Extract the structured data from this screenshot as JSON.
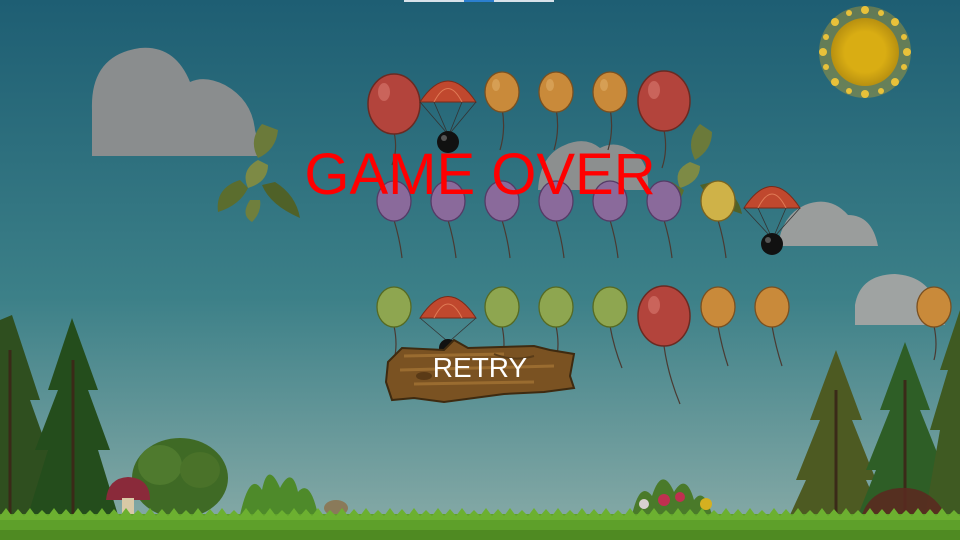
{
  "game": {
    "title": "GAME OVER",
    "retry_label": "RETRY"
  },
  "colors": {
    "sky_top": "#1e5e73",
    "sky_bottom": "#7fa7a9",
    "title": "#ff0000",
    "balloon_red": "#b3443c",
    "balloon_orange": "#c98a3a",
    "balloon_purple": "#8a6a9b",
    "balloon_green": "#8ea650",
    "balloon_yellow": "#cfb248",
    "parachute": "#c0482e",
    "grass": "#5ea02a",
    "sun": "#d9ad13"
  },
  "icons": [
    "sun-icon",
    "cloud-icon",
    "balloon-icon",
    "bomb-parachute-icon",
    "tree-icon",
    "bush-icon",
    "mushroom-icon",
    "leaf-icon"
  ]
}
